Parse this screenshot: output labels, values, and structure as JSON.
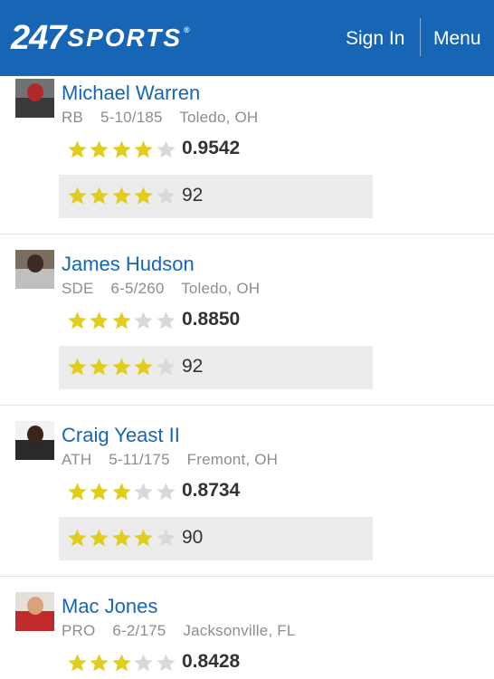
{
  "header": {
    "logo_digits": "247",
    "logo_word": "SPORTS",
    "logo_mark": "®",
    "sign_in": "Sign In",
    "menu": "Menu",
    "bg_color": "#1766b5"
  },
  "colors": {
    "link": "#1766b5",
    "star_on": "#e1cd1e",
    "star_off": "#d9d9d9",
    "box_bg": "#ececec"
  },
  "players": [
    {
      "name": "Michael Warren",
      "position": "RB",
      "measurables": "5-10/185",
      "hometown": "Toledo, OH",
      "composite_stars": 4,
      "composite_rating": "0.9542",
      "sports247_stars": 4,
      "sports247_rating": "92"
    },
    {
      "name": "James Hudson",
      "position": "SDE",
      "measurables": "6-5/260",
      "hometown": "Toledo, OH",
      "composite_stars": 3,
      "composite_rating": "0.8850",
      "sports247_stars": 4,
      "sports247_rating": "92"
    },
    {
      "name": "Craig Yeast II",
      "position": "ATH",
      "measurables": "5-11/175",
      "hometown": "Fremont, OH",
      "composite_stars": 3,
      "composite_rating": "0.8734",
      "sports247_stars": 4,
      "sports247_rating": "90"
    },
    {
      "name": "Mac Jones",
      "position": "PRO",
      "measurables": "6-2/175",
      "hometown": "Jacksonville, FL",
      "composite_stars": 3,
      "composite_rating": "0.8428"
    }
  ]
}
